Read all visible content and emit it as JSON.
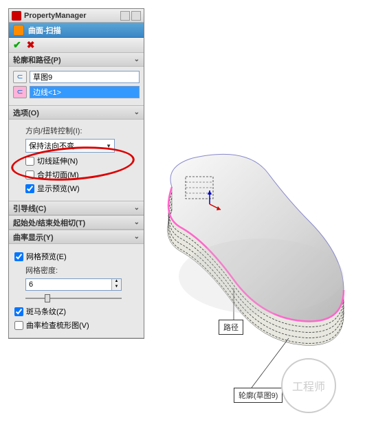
{
  "titlebar": {
    "title": "PropertyManager"
  },
  "feature": {
    "name": "曲面-扫描"
  },
  "sections": {
    "profile_path": {
      "header": "轮廓和路径(P)",
      "profile_value": "草图9",
      "path_value": "边线<1>"
    },
    "options": {
      "header": "选项(O)",
      "orient_label": "方向/扭转控制(I):",
      "orient_value": "保持法向不变",
      "tangent_ext": "切线延伸(N)",
      "merge": "合并切面(M)",
      "preview": "显示预览(W)"
    },
    "guides": {
      "header": "引导线(C)"
    },
    "tangency": {
      "header": "起始处/结束处相切(T)"
    },
    "curvature": {
      "header": "曲率显示(Y)",
      "mesh_preview": "网格预览(E)",
      "mesh_density_label": "网格密度:",
      "mesh_density_value": "6",
      "zebra": "斑马条纹(Z)",
      "comb": "曲率检查梳形图(V)"
    }
  },
  "callouts": {
    "path": "路径",
    "profile": "轮廓(草图9)"
  },
  "watermark": "工程师"
}
